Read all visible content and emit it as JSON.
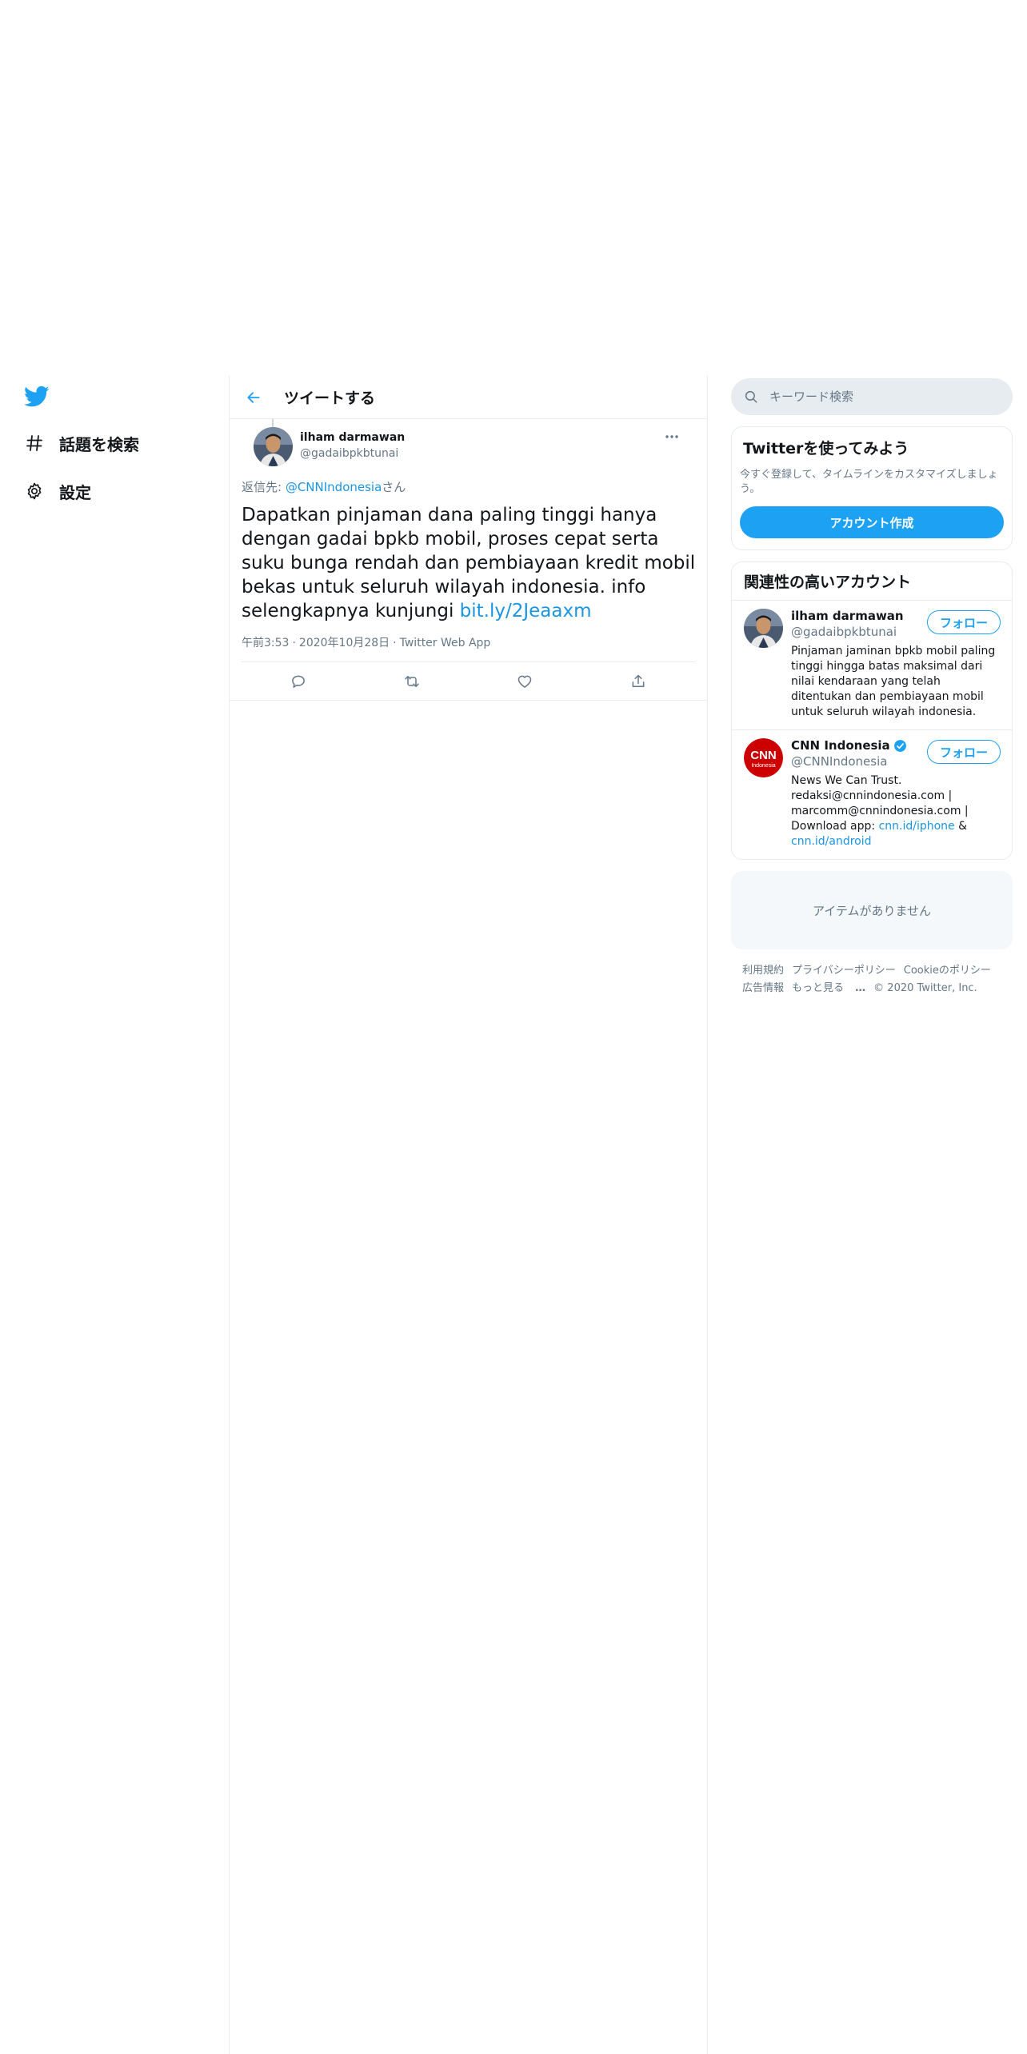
{
  "sidebar": {
    "items": [
      {
        "label": "話題を検索",
        "icon": "hashtag-icon"
      },
      {
        "label": "設定",
        "icon": "gear-icon"
      }
    ]
  },
  "header": {
    "title": "ツイートする"
  },
  "tweet": {
    "author_name": "ilham darmawan",
    "author_handle": "@gadaibpkbtunai",
    "reply_prefix": "返信先: ",
    "reply_handle": "@CNNIndonesia",
    "reply_suffix": "さん",
    "text": "Dapatkan pinjaman dana paling tinggi hanya dengan gadai bpkb mobil, proses cepat serta suku bunga rendah dan pembiayaan kredit mobil bekas untuk seluruh wilayah indonesia. info selengkapnya kunjungi ",
    "link": "bit.ly/2Jeaaxm",
    "time": "午前3:53",
    "date": "2020年10月28日",
    "source": "Twitter Web App"
  },
  "search": {
    "placeholder": "キーワード検索"
  },
  "signup": {
    "title": "Twitterを使ってみよう",
    "description": "今すぐ登録して、タイムラインをカスタマイズしましょう。",
    "button": "アカウント作成"
  },
  "related": {
    "title": "関連性の高いアカウント",
    "follow_label": "フォロー",
    "accounts": [
      {
        "name": "ilham darmawan",
        "handle": "@gadaibpkbtunai",
        "bio": "Pinjaman jaminan bpkb mobil paling tinggi hingga batas maksimal dari nilai kendaraan yang telah ditentukan dan pembiayaan mobil untuk seluruh wilayah indonesia."
      },
      {
        "name": "CNN Indonesia",
        "handle": "@CNNIndonesia",
        "bio": "News We Can Trust. redaksi@cnnindonesia.com | marcomm@cnnindonesia.com | Download app: ",
        "link1": "cnn.id/iphone",
        "bio_mid": " & ",
        "link2": "cnn.id/android",
        "avatar_text": "CNN",
        "avatar_subtext": "Indonesia",
        "verified": true
      }
    ]
  },
  "trends": {
    "empty_text": "アイテムがありません"
  },
  "footer": {
    "links": [
      "利用規約",
      "プライバシーポリシー",
      "Cookieのポリシー",
      "広告情報",
      "もっと見る"
    ],
    "copyright": "© 2020 Twitter, Inc."
  },
  "colors": {
    "accent": "#1da1f2",
    "link": "#1b95e0",
    "muted": "#657786",
    "border": "#e6ecf0",
    "cnn_red": "#cc0000"
  }
}
